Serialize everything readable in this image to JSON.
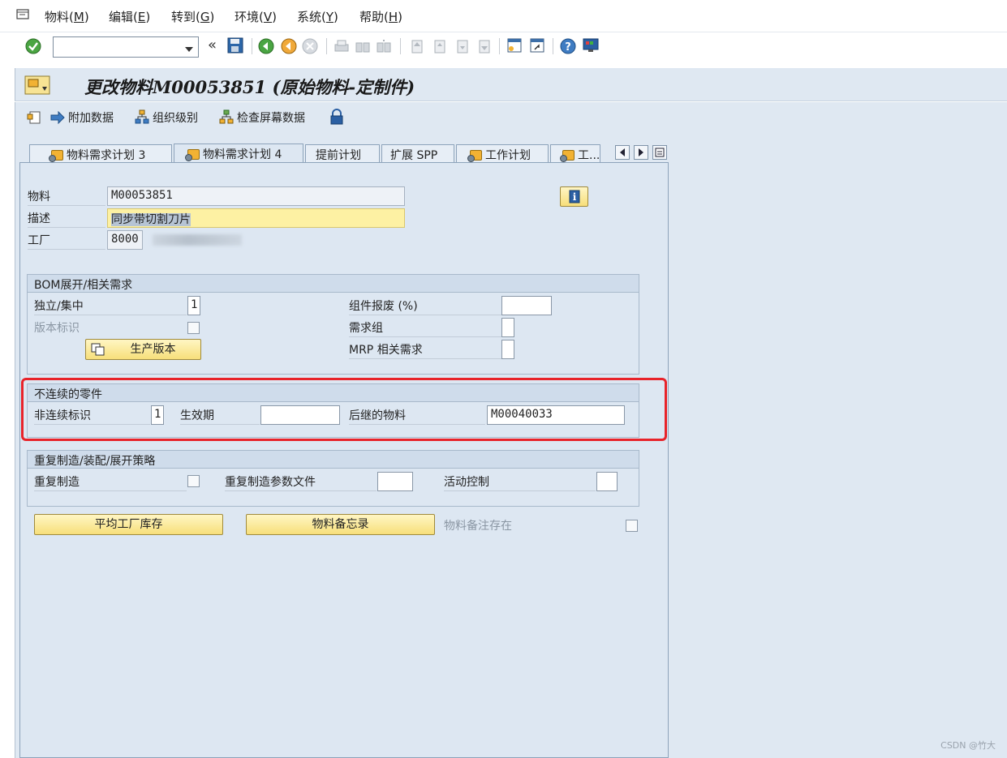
{
  "menu": {
    "items": [
      {
        "label": "物料(",
        "acc": "M",
        "end": ")"
      },
      {
        "label": "编辑(",
        "acc": "E",
        "end": ")"
      },
      {
        "label": "转到(",
        "acc": "G",
        "end": ")"
      },
      {
        "label": "环境(",
        "acc": "V",
        "end": ")"
      },
      {
        "label": "系统(",
        "acc": "Y",
        "end": ")"
      },
      {
        "label": "帮助(",
        "acc": "H",
        "end": ")"
      }
    ]
  },
  "toolbar": {
    "command_field_value": "",
    "back_symbol": "«"
  },
  "title": "更改物料M00053851 (原始物料-定制件)",
  "app_toolbar": {
    "additional_data": "附加数据",
    "org_levels": "组织级别",
    "check_screen_data": "检查屏幕数据"
  },
  "tabs": [
    {
      "label": "物料需求计划 3"
    },
    {
      "label": "物料需求计划 4"
    },
    {
      "label": "提前计划"
    },
    {
      "label": "扩展 SPP"
    },
    {
      "label": "工作计划"
    },
    {
      "label": "工..."
    }
  ],
  "header": {
    "material_label": "物料",
    "material_value": "M00053851",
    "description_label": "描述",
    "description_value": "同步带切割刀片",
    "plant_label": "工厂",
    "plant_value": "8000",
    "info_symbol": "i"
  },
  "bom_group": {
    "title": "BOM展开/相关需求",
    "independent_label": "独立/集中",
    "independent_value": "1",
    "version_label": "版本标识",
    "prod_version_button": "生产版本",
    "component_scrap_label": "组件报废 (%)",
    "component_scrap_value": "",
    "req_group_label": "需求组",
    "req_group_value": "",
    "mrp_dep_label": "MRP 相关需求",
    "mrp_dep_value": ""
  },
  "discontinued_group": {
    "title": "不连续的零件",
    "disc_indicator_label": "非连续标识",
    "disc_indicator_value": "1",
    "effective_label": "生效期",
    "effective_value": "",
    "follow_up_label": "后继的物料",
    "follow_up_value": "M00040033"
  },
  "repetitive_group": {
    "title": "重复制造/装配/展开策略",
    "repetitive_label": "重复制造",
    "profile_label": "重复制造参数文件",
    "profile_value": "",
    "action_control_label": "活动控制",
    "action_control_value": ""
  },
  "bottom": {
    "plant_stock_button": "平均工厂库存",
    "memo_button": "物料备忘录",
    "memo_exists_label": "物料备注存在"
  },
  "watermark": "CSDN @竹大",
  "colors": {
    "background": "#dfe8f2",
    "highlight_box": "#e8232a",
    "yellow_button": "#f7df7a"
  }
}
